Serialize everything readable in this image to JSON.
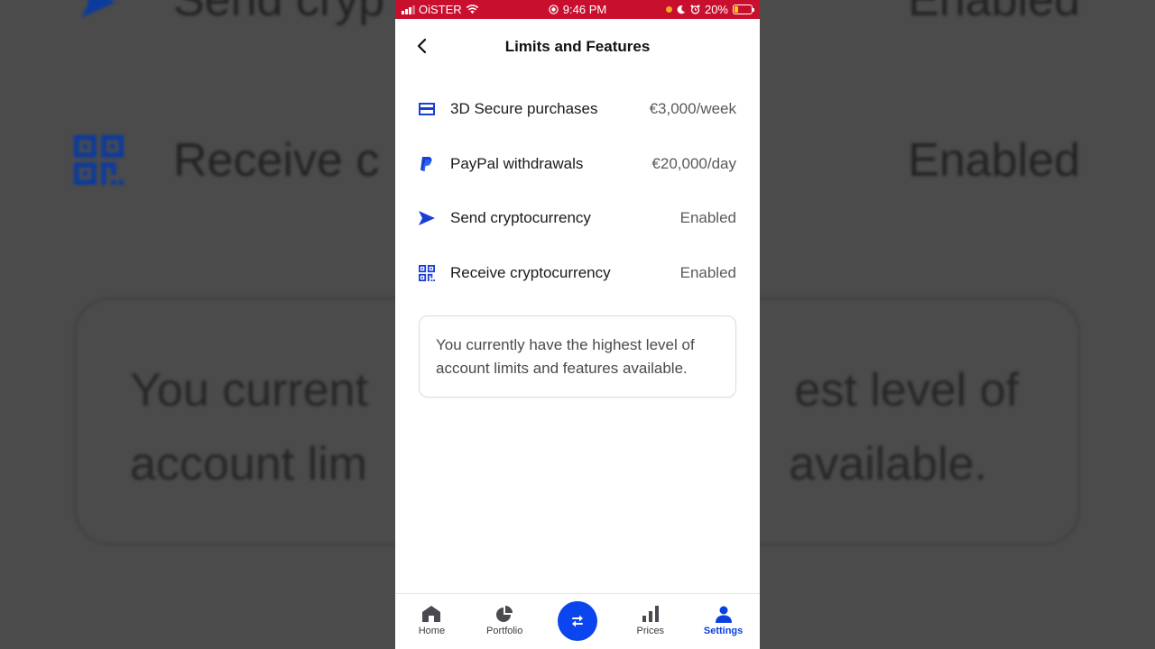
{
  "status_bar": {
    "carrier": "OiSTER",
    "time": "9:46 PM",
    "battery_percent": "20%",
    "battery_level": 0.2
  },
  "header": {
    "title": "Limits and Features",
    "back_icon": "chevron-left-icon"
  },
  "limits": [
    {
      "icon": "card-icon",
      "label": "3D Secure purchases",
      "value": "€3,000/week"
    },
    {
      "icon": "paypal-icon",
      "label": "PayPal withdrawals",
      "value": "€20,000/day"
    },
    {
      "icon": "send-icon",
      "label": "Send cryptocurrency",
      "value": "Enabled"
    },
    {
      "icon": "qr-code-icon",
      "label": "Receive cryptocurrency",
      "value": "Enabled"
    }
  ],
  "info_card": {
    "text": "You currently have the highest level of account limits and features available."
  },
  "tabbar": {
    "items": [
      {
        "icon": "home-icon",
        "label": "Home",
        "active": false
      },
      {
        "icon": "pie-chart-icon",
        "label": "Portfolio",
        "active": false
      },
      {
        "icon": "swap-icon",
        "label": "",
        "active": false
      },
      {
        "icon": "bar-chart-icon",
        "label": "Prices",
        "active": false
      },
      {
        "icon": "user-icon",
        "label": "Settings",
        "active": true
      }
    ]
  },
  "background": {
    "row_top_label": "Send cryp",
    "row_top_value": "Enabled",
    "row_label": "Receive c",
    "row_value": "Enabled",
    "card_line1_left": "You current",
    "card_line1_right": "est level of",
    "card_line2_left": "account lim",
    "card_line2_right": "available."
  },
  "colors": {
    "accent": "#0b45f0",
    "status_bar": "#c8102e",
    "active_tab": "#0a3fe0"
  }
}
